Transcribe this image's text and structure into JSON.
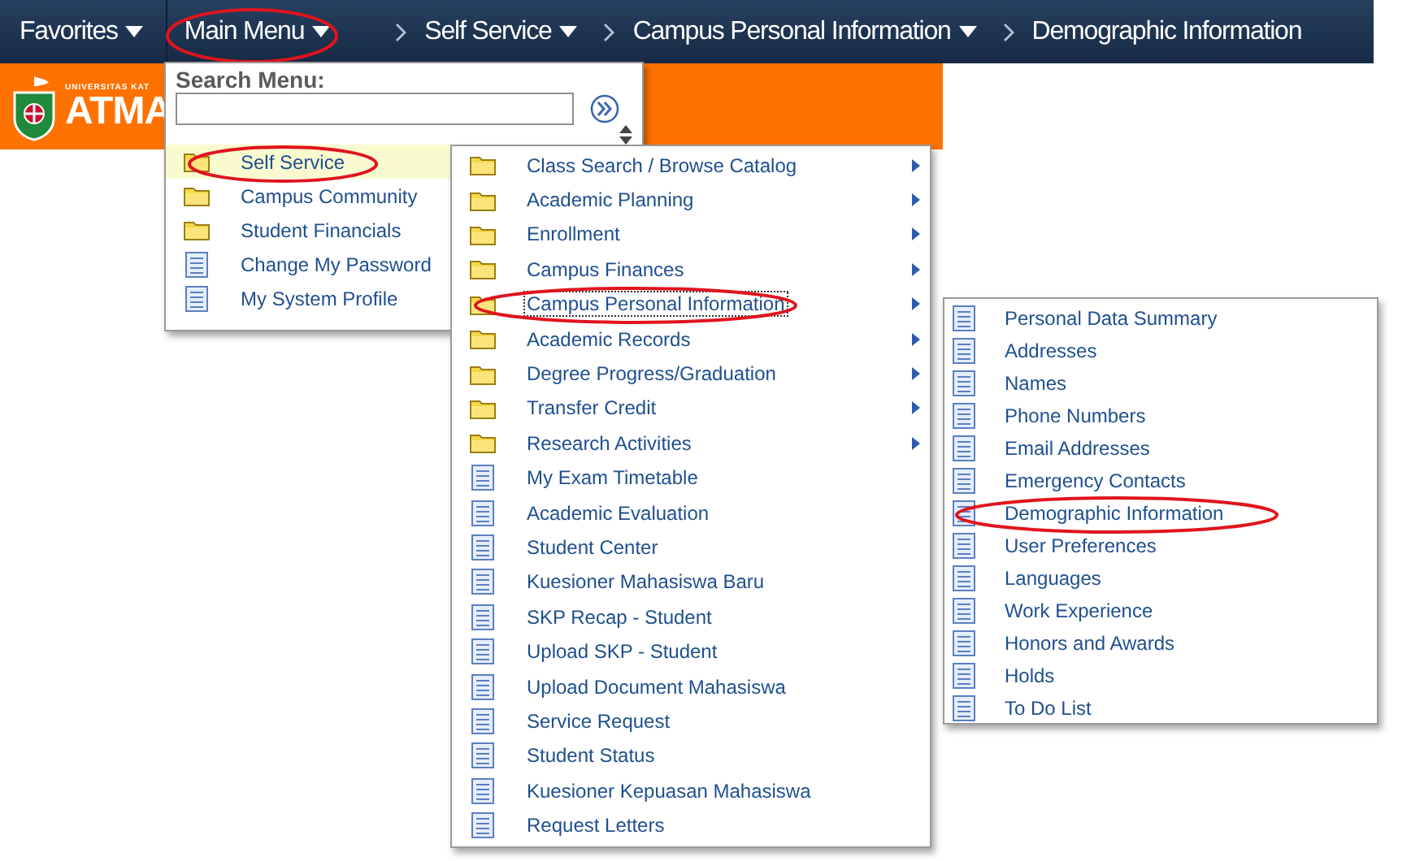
{
  "nav": {
    "menus": [
      {
        "label": "Favorites",
        "circled": false
      },
      {
        "label": "Main Menu",
        "circled": true
      }
    ],
    "breadcrumbs": [
      {
        "label": "Self Service",
        "dropdown": true
      },
      {
        "label": "Campus Personal Information",
        "dropdown": true
      },
      {
        "label": "Demographic Information",
        "dropdown": false
      }
    ]
  },
  "banner": {
    "logo_small": "UNIVERSITAS KAT",
    "logo_text": "ATMA"
  },
  "main_menu": {
    "search_label": "Search Menu:",
    "show_arrows": false,
    "items": [
      {
        "label": "Self Service",
        "kind": "folder",
        "selected": true,
        "circled": true
      },
      {
        "label": "Campus Community",
        "kind": "folder",
        "selected": false,
        "circled": false
      },
      {
        "label": "Student Financials",
        "kind": "folder",
        "selected": false,
        "circled": false
      },
      {
        "label": "Change My Password",
        "kind": "page",
        "selected": false,
        "circled": false
      },
      {
        "label": "My System Profile",
        "kind": "page",
        "selected": false,
        "circled": false
      }
    ]
  },
  "submenu": {
    "show_arrows": true,
    "items": [
      {
        "label": "Class Search / Browse Catalog",
        "kind": "folder",
        "selected": false,
        "circled": false
      },
      {
        "label": "Academic Planning",
        "kind": "folder",
        "selected": false,
        "circled": false
      },
      {
        "label": "Enrollment",
        "kind": "folder",
        "selected": false,
        "circled": false
      },
      {
        "label": "Campus Finances",
        "kind": "folder",
        "selected": false,
        "circled": false
      },
      {
        "label": "Campus Personal Information",
        "kind": "folder",
        "selected": true,
        "circled": true
      },
      {
        "label": "Academic Records",
        "kind": "folder",
        "selected": false,
        "circled": false
      },
      {
        "label": "Degree Progress/Graduation",
        "kind": "folder",
        "selected": false,
        "circled": false
      },
      {
        "label": "Transfer Credit",
        "kind": "folder",
        "selected": false,
        "circled": false
      },
      {
        "label": "Research Activities",
        "kind": "folder",
        "selected": false,
        "circled": false
      },
      {
        "label": "My Exam Timetable",
        "kind": "page",
        "selected": false,
        "circled": false
      },
      {
        "label": "Academic Evaluation",
        "kind": "page",
        "selected": false,
        "circled": false
      },
      {
        "label": "Student Center",
        "kind": "page",
        "selected": false,
        "circled": false
      },
      {
        "label": "Kuesioner Mahasiswa Baru",
        "kind": "page",
        "selected": false,
        "circled": false
      },
      {
        "label": "SKP Recap - Student",
        "kind": "page",
        "selected": false,
        "circled": false
      },
      {
        "label": "Upload SKP - Student",
        "kind": "page",
        "selected": false,
        "circled": false
      },
      {
        "label": "Upload Document Mahasiswa",
        "kind": "page",
        "selected": false,
        "circled": false
      },
      {
        "label": "Service Request",
        "kind": "page",
        "selected": false,
        "circled": false
      },
      {
        "label": "Student Status",
        "kind": "page",
        "selected": false,
        "circled": false
      },
      {
        "label": "Kuesioner Kepuasan Mahasiswa",
        "kind": "page",
        "selected": false,
        "circled": false
      },
      {
        "label": "Request Letters",
        "kind": "page",
        "selected": false,
        "circled": false
      }
    ]
  },
  "subsubmenu": {
    "show_arrows": false,
    "items": [
      {
        "label": "Personal Data Summary",
        "kind": "page",
        "selected": false,
        "circled": false
      },
      {
        "label": "Addresses",
        "kind": "page",
        "selected": false,
        "circled": false
      },
      {
        "label": "Names",
        "kind": "page",
        "selected": false,
        "circled": false
      },
      {
        "label": "Phone Numbers",
        "kind": "page",
        "selected": false,
        "circled": false
      },
      {
        "label": "Email Addresses",
        "kind": "page",
        "selected": false,
        "circled": false
      },
      {
        "label": "Emergency Contacts",
        "kind": "page",
        "selected": false,
        "circled": false
      },
      {
        "label": "Demographic Information",
        "kind": "page",
        "selected": false,
        "circled": true
      },
      {
        "label": "User Preferences",
        "kind": "page",
        "selected": false,
        "circled": false
      },
      {
        "label": "Languages",
        "kind": "page",
        "selected": false,
        "circled": false
      },
      {
        "label": "Work Experience",
        "kind": "page",
        "selected": false,
        "circled": false
      },
      {
        "label": "Honors and Awards",
        "kind": "page",
        "selected": false,
        "circled": false
      },
      {
        "label": "Holds",
        "kind": "page",
        "selected": false,
        "circled": false
      },
      {
        "label": "To Do List",
        "kind": "page",
        "selected": false,
        "circled": false
      }
    ]
  }
}
